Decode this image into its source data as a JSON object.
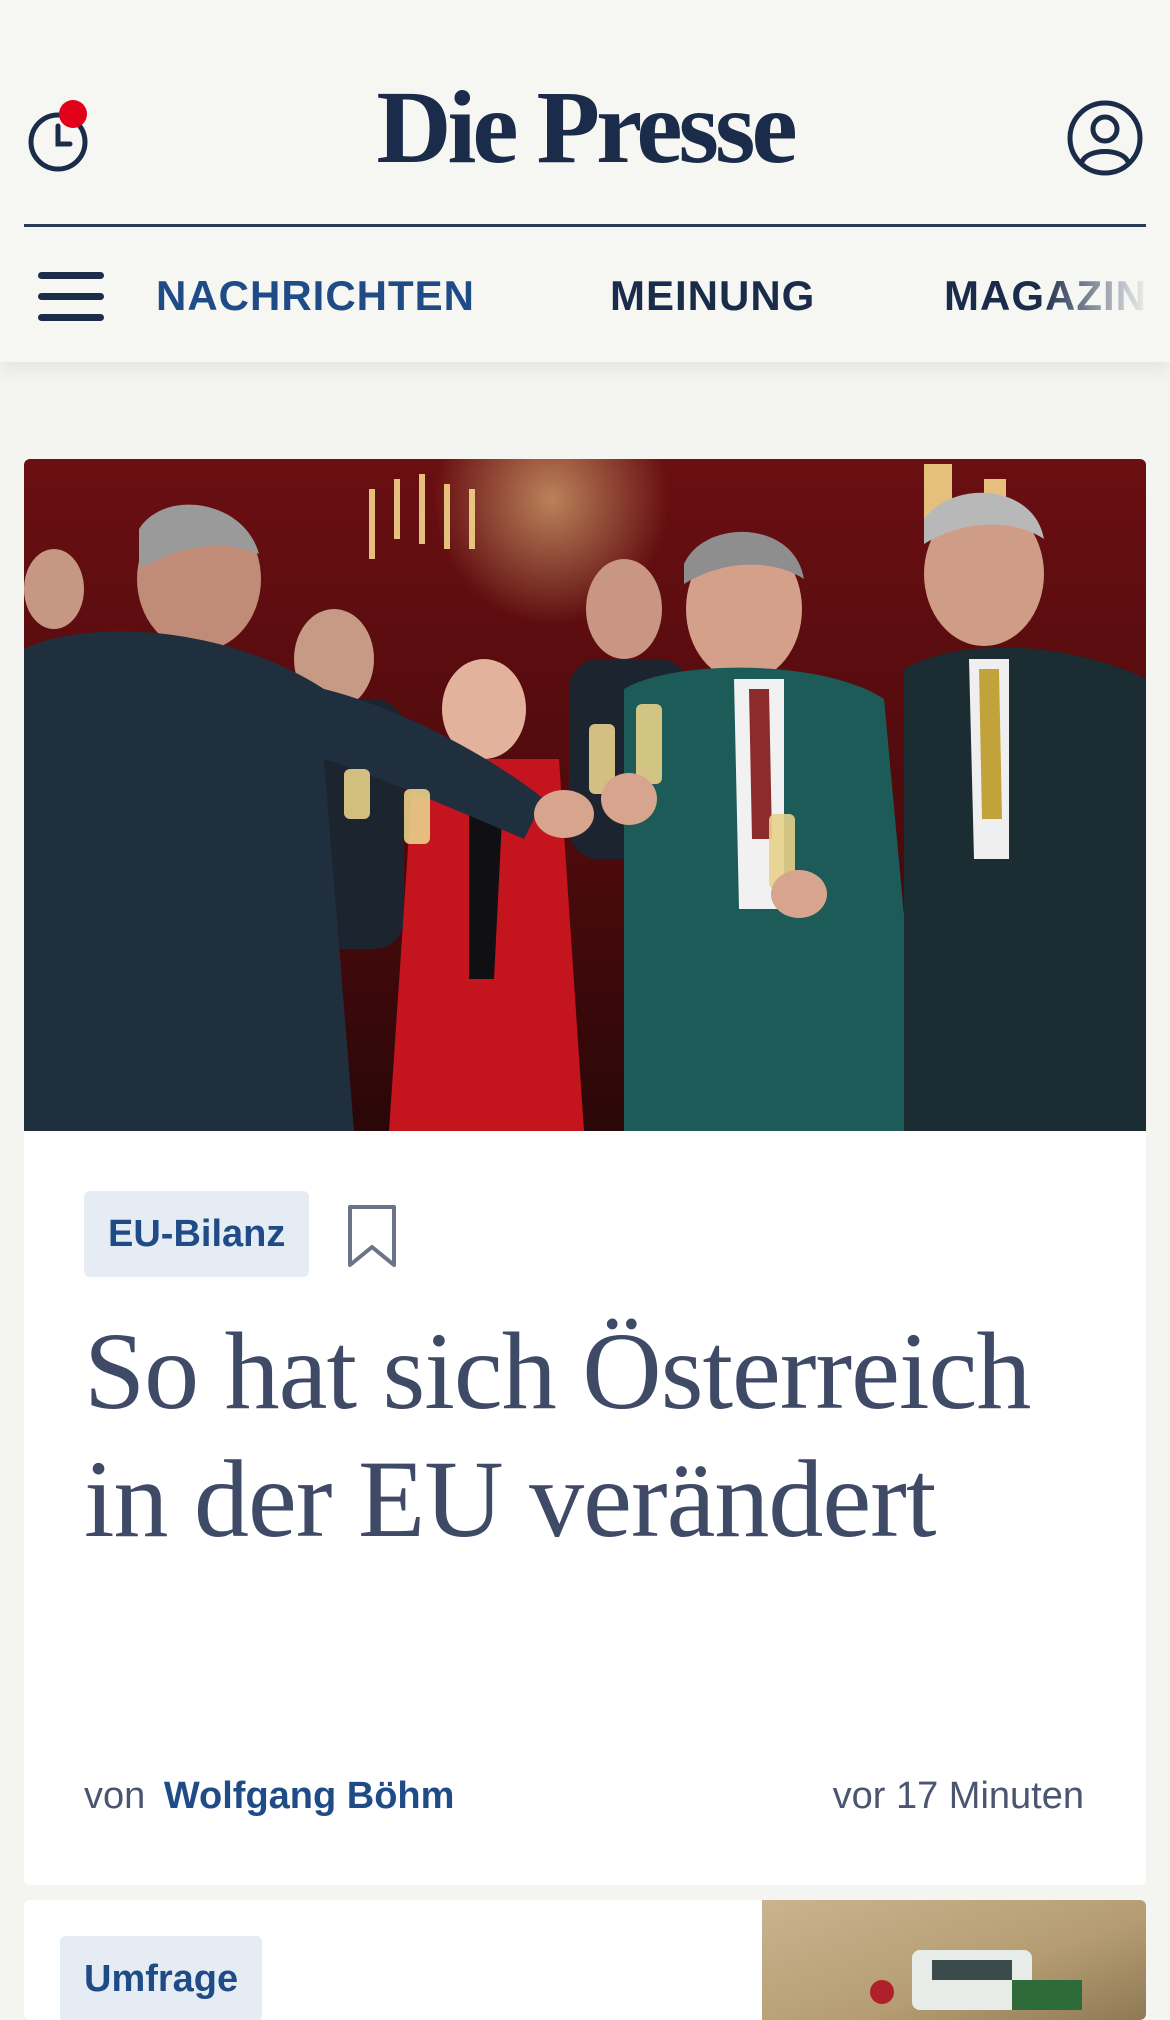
{
  "header": {
    "logo": "Die Presse",
    "icons": {
      "history": "clock-icon",
      "user": "user-icon",
      "menu": "hamburger-icon"
    },
    "nav": [
      "NACHRICHTEN",
      "MEINUNG",
      "MAGAZIN"
    ]
  },
  "article": {
    "image_alt": "Politiker stoßen mit Sektgläsern an",
    "tag": "EU-Bilanz",
    "headline": "So hat sich Österreich in der EU verändert",
    "byline_prefix": "von",
    "author": "Wolfgang Böhm",
    "time": "vor 17 Minuten"
  },
  "next_article": {
    "tag": "Umfrage"
  },
  "colors": {
    "brand_navy": "#1b2c4a",
    "link_blue": "#1f4b87",
    "notification_red": "#e2001a",
    "tag_bg": "#e6ecf3"
  }
}
